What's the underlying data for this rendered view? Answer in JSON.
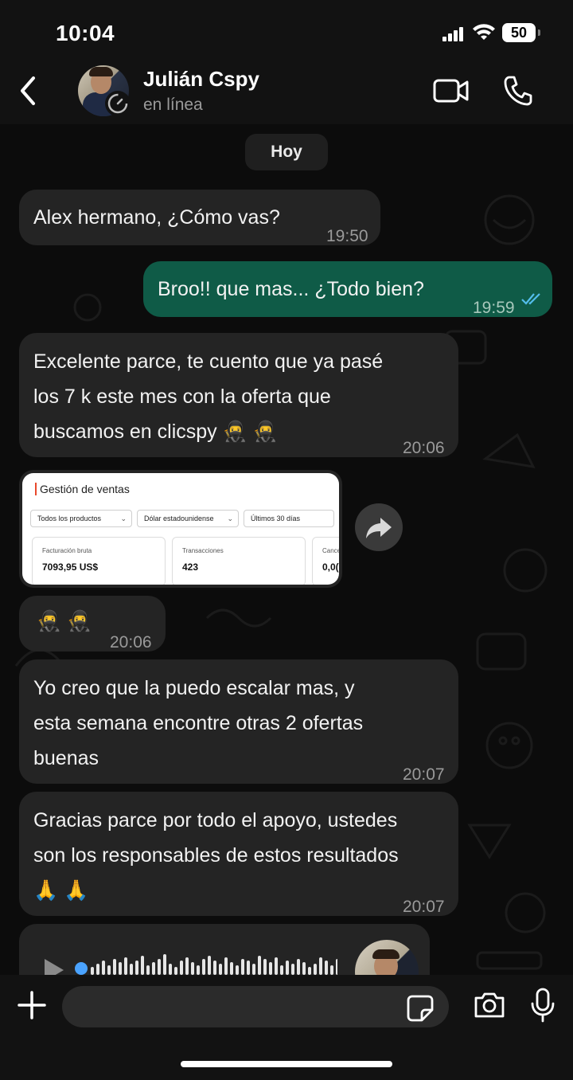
{
  "status_bar": {
    "time": "10:04",
    "battery": "50"
  },
  "header": {
    "contact_name": "Julián Cspy",
    "presence": "en línea"
  },
  "chat": {
    "day_separator": "Hoy",
    "messages": [
      {
        "text": "Alex hermano, ¿Cómo vas?",
        "time": "19:50"
      },
      {
        "text": "Broo!! que mas... ¿Todo bien?",
        "time": "19:59"
      },
      {
        "line1": "Excelente parce, te cuento que ya pasé",
        "line2": "los 7 k este mes con la oferta que",
        "line3": "buscamos en clicspy 🥷 🥷",
        "time": "20:06"
      },
      {
        "text": "🥷 🥷",
        "time": "20:06"
      },
      {
        "line1": "Yo creo que la puedo escalar mas, y",
        "line2": "esta semana encontre otras 2 ofertas",
        "line3": "buenas",
        "time": "20:07"
      },
      {
        "line1": "Gracias parce por todo el apoyo, ustedes",
        "line2": "son los responsables de estos resultados",
        "line3": "🙏 🙏",
        "time": "20:07"
      }
    ],
    "image_message": {
      "title": "Gestión de ventas",
      "filters": [
        "Todos los productos",
        "Dólar estadounidense",
        "Últimos 30 días"
      ],
      "kpis": [
        {
          "label": "Facturación bruta",
          "value": "7093,95 US$"
        },
        {
          "label": "Transacciones",
          "value": "423"
        },
        {
          "label": "Cancel",
          "value": "0,0("
        }
      ]
    }
  },
  "colors": {
    "incoming_bubble": "#242424",
    "outgoing_bubble": "#0f5b47",
    "read_ticks": "#53bdeb"
  }
}
